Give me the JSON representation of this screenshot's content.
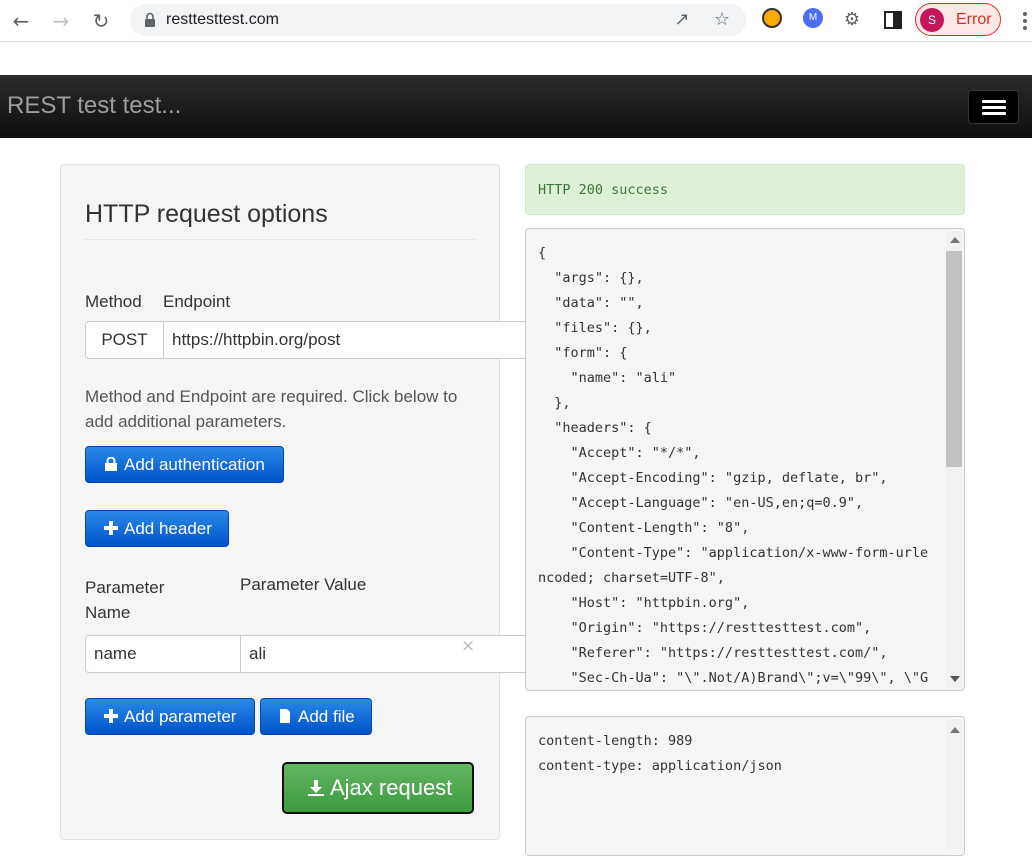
{
  "browser": {
    "url": "resttesttest.com",
    "profile_initial": "S",
    "profile_status": "Error"
  },
  "app": {
    "brand": "REST test test..."
  },
  "request_panel": {
    "title": "HTTP request options",
    "method_label": "Method",
    "endpoint_label": "Endpoint",
    "method_value": "POST",
    "endpoint_value": "https://httpbin.org/post",
    "help_text": "Method and Endpoint are required. Click below to add additional parameters.",
    "add_auth_label": "Add authentication",
    "add_header_label": "Add header",
    "param_name_label": "Parameter Name",
    "param_value_label": "Parameter Value",
    "param_name_value": "name",
    "param_value_value": "ali",
    "clear_symbol": "×",
    "add_param_label": "Add parameter",
    "add_file_label": "Add file",
    "ajax_label": "Ajax request"
  },
  "response": {
    "status_text": "HTTP 200 success",
    "body_lines": [
      "{",
      "  \"args\": {},",
      "  \"data\": \"\",",
      "  \"files\": {},",
      "  \"form\": {",
      "    \"name\": \"ali\"",
      "  },",
      "  \"headers\": {",
      "    \"Accept\": \"*/*\",",
      "    \"Accept-Encoding\": \"gzip, deflate, br\",",
      "    \"Accept-Language\": \"en-US,en;q=0.9\",",
      "    \"Content-Length\": \"8\",",
      "    \"Content-Type\": \"application/x-www-form-urle",
      "ncoded; charset=UTF-8\",",
      "    \"Host\": \"httpbin.org\",",
      "    \"Origin\": \"https://resttesttest.com\",",
      "    \"Referer\": \"https://resttesttest.com/\",",
      "    \"Sec-Ch-Ua\": \"\\\".Not/A)Brand\\\";v=\\\"99\\\", \\\"G"
    ],
    "header_lines": [
      "content-length: 989",
      "content-type: application/json"
    ]
  }
}
